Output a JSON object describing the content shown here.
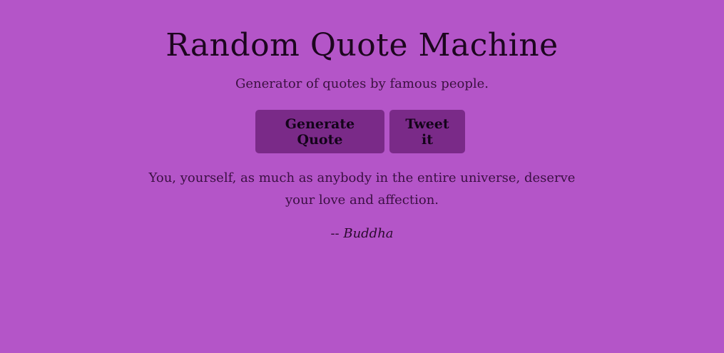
{
  "header": {
    "title": "Random Quote Machine",
    "subtitle": "Generator of quotes by famous people."
  },
  "buttons": {
    "generate_label": "Generate Quote",
    "tweet_label": "Tweet it"
  },
  "quote": {
    "text": "You, yourself, as much as anybody in the entire universe, deserve your love and affection.",
    "author_prefix": "-- ",
    "author": "Buddha"
  },
  "colors": {
    "background": "#b455c8",
    "button_bg": "#7a2a88",
    "text_dark": "#1d061f"
  }
}
